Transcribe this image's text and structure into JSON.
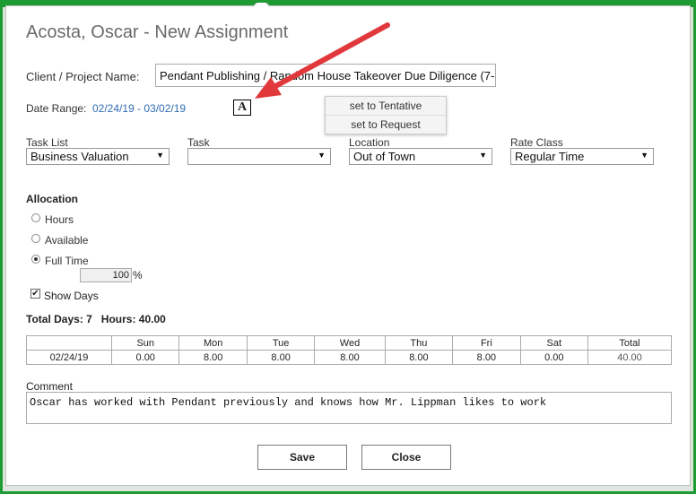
{
  "dialog": {
    "title": "Acosta, Oscar - New Assignment",
    "client_project_label": "Client / Project Name:",
    "client_project_value": "Pendant Publishing / Random House Takeover Due Diligence (7-",
    "date_range_label": "Date Range:",
    "date_range_value": "02/24/19 - 03/02/19",
    "annotation_letter": "A"
  },
  "status_menu": {
    "items": [
      "set to Tentative",
      "set to Request"
    ]
  },
  "selects": {
    "task_list": {
      "label": "Task List",
      "value": "Business Valuation"
    },
    "task": {
      "label": "Task",
      "value": ""
    },
    "location": {
      "label": "Location",
      "value": "Out of Town"
    },
    "rate_class": {
      "label": "Rate Class",
      "value": "Regular Time"
    }
  },
  "allocation": {
    "title": "Allocation",
    "options": [
      "Hours",
      "Available",
      "Full Time"
    ],
    "selected": "Full Time",
    "percent_value": "100",
    "percent_sign": "%",
    "show_days_label": "Show Days",
    "show_days_checked": true
  },
  "totals": {
    "text": "Total Days: 7   Hours: 40.00"
  },
  "days_table": {
    "headers": [
      "",
      "Sun",
      "Mon",
      "Tue",
      "Wed",
      "Thu",
      "Fri",
      "Sat",
      "Total"
    ],
    "row": [
      "02/24/19",
      "0.00",
      "8.00",
      "8.00",
      "8.00",
      "8.00",
      "8.00",
      "0.00",
      "40.00"
    ]
  },
  "comment": {
    "label": "Comment",
    "value": "Oscar has worked with Pendant previously and knows how Mr. Lippman likes to work"
  },
  "buttons": {
    "save": "Save",
    "close": "Close"
  },
  "colors": {
    "frame_green": "#1e9b33",
    "link_blue": "#2f6bb3",
    "annotation_arrow": "#e0383b"
  }
}
